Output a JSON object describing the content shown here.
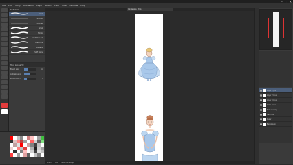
{
  "window": {
    "minimize": "–",
    "maximize": "□",
    "close": "✕"
  },
  "menu": [
    "File",
    "Edit",
    "Story",
    "Animation",
    "Layer",
    "Select",
    "View",
    "Filter",
    "Window",
    "Help"
  ],
  "subtool": {
    "tabs": [
      "Sub tool"
    ],
    "items": [
      {
        "label": "Brush",
        "brush_color": "#e6e6e6"
      },
      {
        "label": "Smooth",
        "brush_color": "#e6e6e6"
      },
      {
        "label": "Lighten",
        "brush_color": "#e6e6e6"
      },
      {
        "label": "Brush",
        "brush_color": "#e6e6e6"
      },
      {
        "label": "Stroke",
        "brush_color": "#e6e6e6"
      },
      {
        "label": "Gradation ink",
        "brush_color": "#ffffff"
      },
      {
        "label": "Blend ink",
        "brush_color": "#ffffff"
      },
      {
        "label": "Variable",
        "brush_color": "#ffffff"
      },
      {
        "label": "Soft blend",
        "brush_color": "#ffffff"
      }
    ]
  },
  "toolprop": {
    "title": "Tool property",
    "rows": [
      {
        "name": "Brush size",
        "value": "8.0",
        "fill": 0.35
      },
      {
        "name": "Anti-aliasing",
        "value": "",
        "fill": 0.5
      },
      {
        "name": "Stabilization",
        "value": "6",
        "fill": 0.2
      }
    ]
  },
  "colors": {
    "main": "#e23c3c",
    "sub": "#ffffff",
    "swatches": [
      "#ff0000",
      "#ffffff",
      "#c0c0c0",
      "#8a8a8a",
      "#ffffff",
      "#d08080",
      "#ffc0c0",
      "#ffffff",
      "#a0a0a0",
      "#40c040",
      "#303030",
      "#e0c0c0",
      "#ff8080",
      "#c04040",
      "#a0a0a0",
      "#ffffff",
      "#ff6060",
      "#d0d0d0",
      "#606060",
      "#80e080",
      "#ffffff",
      "#c0a0a0",
      "#e0e0e0",
      "#ff0000",
      "#ffffff",
      "#d0a0a0",
      "#808080",
      "#404040",
      "#c0c0c0",
      "#ffffff",
      "#f0d0d0",
      "#ffffff",
      "#ff8080",
      "#c0c0c0",
      "#e04040",
      "#ffffff",
      "#b0b0b0",
      "#202020",
      "#d0d0d0",
      "#a0a0a0",
      "#ffffff",
      "#303030",
      "#ffffff",
      "#808080",
      "#ffc0c0",
      "#ffffff",
      "#d0d0d0",
      "#404040",
      "#e0e0e0",
      "#c0c0c0",
      "#ff4040",
      "#ffffff",
      "#a0a0a0",
      "#ffffff",
      "#e0a0a0",
      "#606060",
      "#ffffff",
      "#c0c0c0",
      "#808080",
      "#ffffff"
    ]
  },
  "canvas": {
    "tab_label": "Cinderella_strip",
    "page_bg": "#ffffff",
    "status": [
      "100.0",
      "0.0",
      "1000 x 5500 px"
    ]
  },
  "layers": [
    {
      "name": "Layer 1 (Fill)",
      "selected": true
    },
    {
      "name": "Layer 2 Lines"
    },
    {
      "name": "Layer 3 Lines"
    },
    {
      "name": "Color dress"
    },
    {
      "name": "Skin shading"
    },
    {
      "name": "Hair color"
    },
    {
      "name": "Paper"
    },
    {
      "name": "Background"
    }
  ]
}
